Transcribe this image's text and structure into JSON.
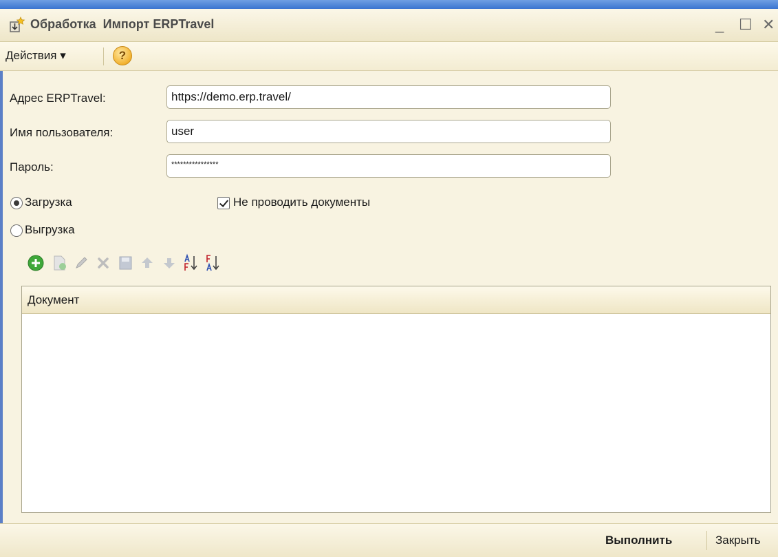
{
  "window": {
    "title": "Обработка  Импорт ERPTravel",
    "controls": {
      "minimize": "_",
      "maximize": "☐",
      "close": "✕"
    }
  },
  "menu": {
    "actions_label": "Действия ▾",
    "help_icon": "help-icon",
    "help_glyph": "?"
  },
  "form": {
    "address_label": "Адрес ERPTravel:",
    "address_value": "https://demo.erp.travel/",
    "username_label": "Имя пользователя:",
    "username_value": "user",
    "password_label": "Пароль:",
    "password_value": "****************",
    "mode_options": [
      {
        "label": "Загрузка",
        "selected": true
      },
      {
        "label": "Выгрузка",
        "selected": false
      }
    ],
    "no_post_label": "Не проводить документы",
    "no_post_checked": true
  },
  "toolbar": {
    "icons": [
      "add-icon",
      "copy-icon",
      "edit-icon",
      "delete-icon",
      "save-icon",
      "move-up-icon",
      "move-down-icon",
      "sort-asc-icon",
      "sort-desc-icon"
    ]
  },
  "table": {
    "columns": [
      "Документ"
    ],
    "rows": []
  },
  "footer": {
    "run_label": "Выполнить",
    "close_label": "Закрыть"
  },
  "colors": {
    "accent_blue": "#3a74d0",
    "panel_bg": "#f8f3e1",
    "add_green": "#3fa83a"
  }
}
